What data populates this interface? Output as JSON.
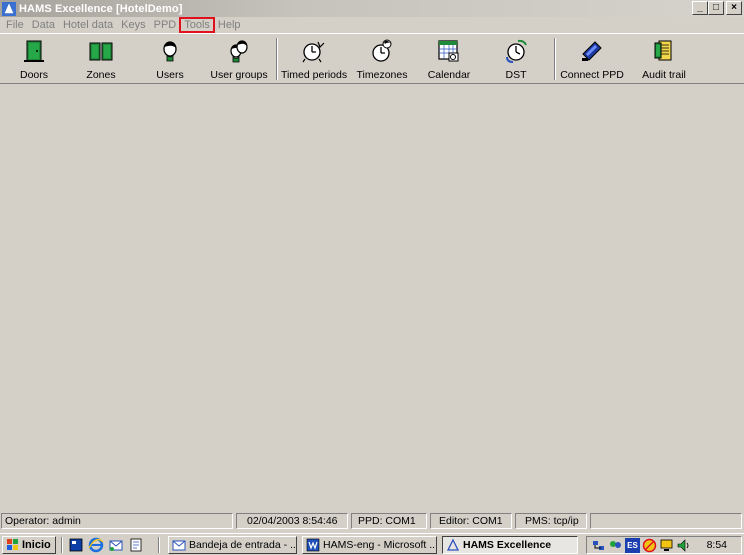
{
  "window": {
    "title": "HAMS Excellence [HotelDemo]",
    "min_label": "_",
    "max_label": "□",
    "close_label": "×"
  },
  "menu": {
    "items": [
      "File",
      "Data",
      "Hotel data",
      "Keys",
      "PPD",
      "Tools",
      "Help"
    ],
    "highlighted": "Tools"
  },
  "toolbar": {
    "buttons": [
      {
        "label": "Doors",
        "icon": "door-icon"
      },
      {
        "label": "Zones",
        "icon": "zones-icon"
      },
      {
        "label": "Users",
        "icon": "user-icon"
      },
      {
        "label": "User groups",
        "icon": "user-group-icon"
      },
      {
        "label": "Timed periods",
        "icon": "timed-periods-icon"
      },
      {
        "label": "Timezones",
        "icon": "timezones-icon"
      },
      {
        "label": "Calendar",
        "icon": "calendar-icon"
      },
      {
        "label": "DST",
        "icon": "dst-clock-icon"
      },
      {
        "label": "Connect PPD",
        "icon": "ppd-device-icon"
      },
      {
        "label": "Audit trail",
        "icon": "audit-trail-icon"
      }
    ]
  },
  "statusbar": {
    "operator": "Operator: admin",
    "datetime": "02/04/2003 8:54:46",
    "ppd": "PPD: COM1",
    "editor": "Editor: COM1",
    "pms": "PMS: tcp/ip",
    "extra": ""
  },
  "taskbar": {
    "start_label": "Inicio",
    "tasks": [
      {
        "label": "Bandeja de entrada - ...",
        "icon": "inbox-icon",
        "active": false
      },
      {
        "label": "HAMS-eng - Microsoft ...",
        "icon": "word-document-icon",
        "active": false
      },
      {
        "label": "HAMS Excellence",
        "icon": "hams-app-icon",
        "active": true
      }
    ],
    "tray_lang": "ES",
    "clock": "8:54"
  },
  "colors": {
    "face": "#d4d0c8",
    "highlight_box": "#e0101c",
    "door_green": "#1f8a3a",
    "xp_blue": "#0b3ea6"
  }
}
